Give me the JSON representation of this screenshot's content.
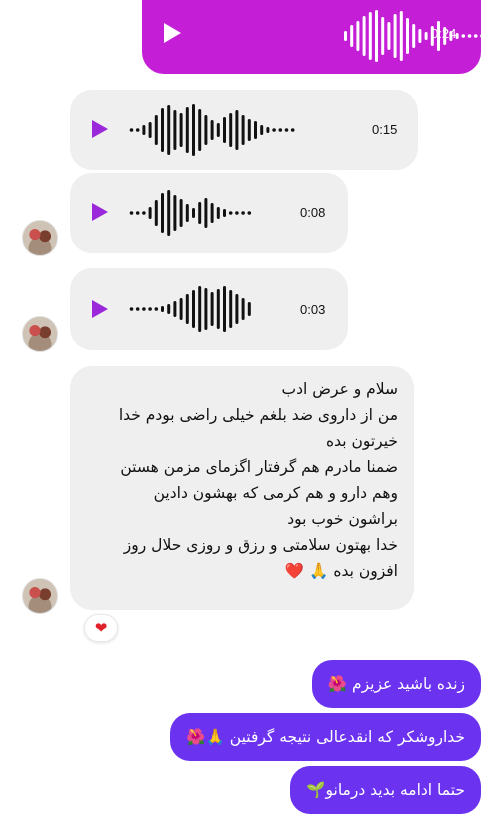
{
  "voice_sent": {
    "duration": "0:24"
  },
  "voice_received": [
    {
      "duration": "0:15"
    },
    {
      "duration": "0:08"
    },
    {
      "duration": "0:03"
    }
  ],
  "received_text": {
    "lines": [
      "سلام و عرض ادب",
      "من از داروی ضد بلغم خیلی راضی بودم خدا",
      "خیرتون بده",
      "ضمنا مادرم هم گرفتار اگزمای مزمن هستن",
      "وهم دارو و هم کرمی که بهشون دادین",
      "براشون خوب بود",
      "خدا بهتون سلامتی و رزق و روزی حلال روز"
    ],
    "last_line": "افزون بده 🙏",
    "last_emoji": "❤️"
  },
  "reaction": "❤",
  "sent_texts": [
    "زنده باشید عزیزم 🌺",
    "خداروشکر که انقدعالی نتیجه گرفتین 🙏🌺",
    "حتما ادامه بدید درمانو🌱"
  ],
  "colors": {
    "sent_voice_bg": "#c41fd6",
    "sent_text_bg": "#6b32f0",
    "received_bg": "#efefef",
    "play_icon_received": "#9a27d9"
  }
}
